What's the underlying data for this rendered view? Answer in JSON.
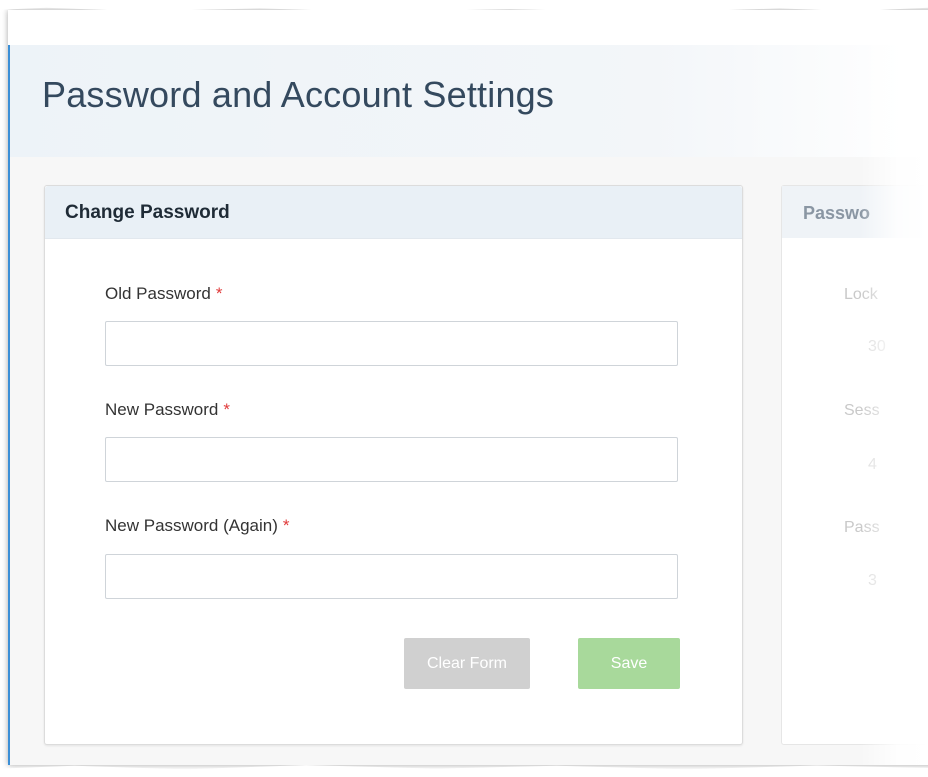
{
  "page": {
    "title": "Password and Account Settings"
  },
  "change_password": {
    "title": "Change Password",
    "fields": [
      {
        "label": "Old Password",
        "required_mark": "*",
        "value": ""
      },
      {
        "label": "New Password",
        "required_mark": "*",
        "value": ""
      },
      {
        "label": "New Password (Again)",
        "required_mark": "*",
        "value": ""
      }
    ],
    "clear_label": "Clear Form",
    "save_label": "Save"
  },
  "side_panel": {
    "title": "Passwo",
    "labels": [
      "Lock",
      "Sess",
      "Pass"
    ],
    "values": [
      "30",
      "4",
      "3"
    ]
  },
  "colors": {
    "accent": "#3b8fd6",
    "required": "#e03a3a",
    "save_button": "#a8d99b",
    "clear_button": "#d0d0d0",
    "header_band": "#edf3f8"
  }
}
